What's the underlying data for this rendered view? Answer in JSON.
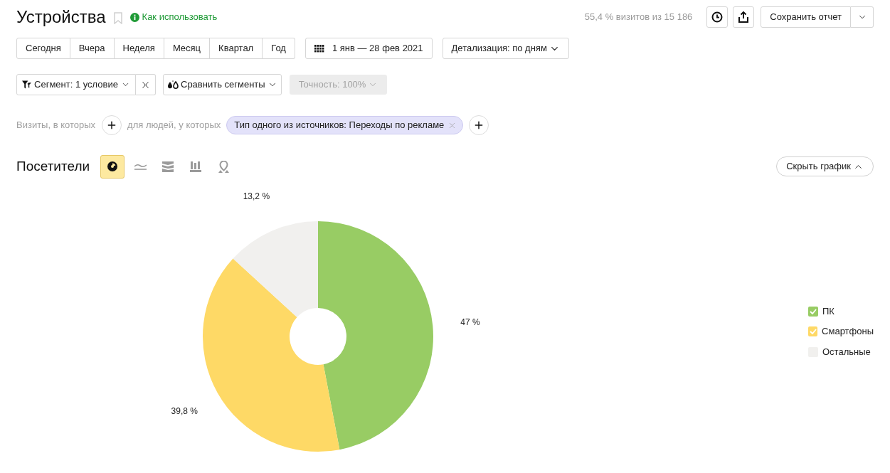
{
  "header": {
    "title": "Устройства",
    "help_link": "Как использовать",
    "sample_info": "55,4 % визитов из 15 186",
    "save_button": "Сохранить отчет"
  },
  "periods": [
    "Сегодня",
    "Вчера",
    "Неделя",
    "Месяц",
    "Квартал",
    "Год"
  ],
  "date_range": "1 янв — 28 фев 2021",
  "detail_select": "Детализация: по дням",
  "segment": {
    "label": "Сегмент: 1 условие",
    "compare": "Сравнить сегменты",
    "accuracy": {
      "label": "Точность: 100%",
      "disabled": true
    }
  },
  "conditions": {
    "visits_label": "Визиты, в которых",
    "people_label": "для людей, у которых",
    "chips": [
      "Тип одного из источников: Переходы по рекламе"
    ]
  },
  "chart_section": {
    "title": "Посетители",
    "chart_types": [
      {
        "kind": "pie",
        "selected": true
      },
      {
        "kind": "line",
        "selected": false
      },
      {
        "kind": "area",
        "selected": false
      },
      {
        "kind": "bar",
        "selected": false
      },
      {
        "kind": "map",
        "selected": false
      }
    ],
    "hide_button": "Скрыть график",
    "chart_data": {
      "type": "donut",
      "categories": [
        "ПК",
        "Смартфоны",
        "Остальные"
      ],
      "values": [
        47,
        39.8,
        13.2
      ],
      "value_labels": [
        "47 %",
        "39,8 %",
        "13,2 %"
      ]
    },
    "legend": [
      {
        "color": "#98cc64",
        "checked": true
      },
      {
        "color": "#fed966",
        "checked": true
      },
      {
        "color": "#f1f0ee",
        "checked": false
      }
    ]
  }
}
